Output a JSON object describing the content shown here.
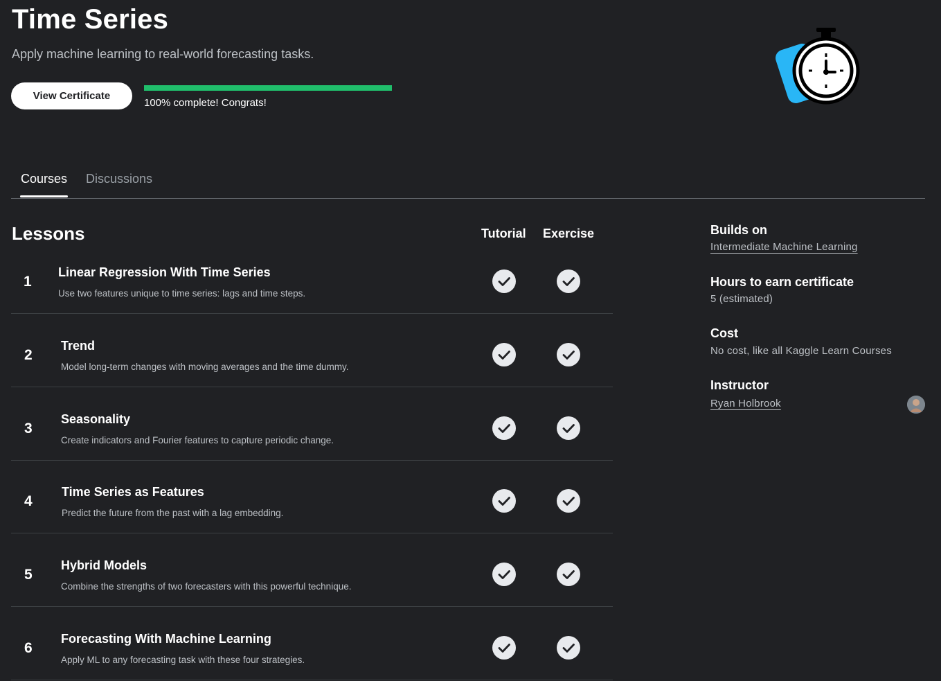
{
  "header": {
    "title": "Time Series",
    "subtitle": "Apply machine learning to real-world forecasting tasks.",
    "certificate_button": "View Certificate",
    "progress_percent": 100,
    "progress_text": "100% complete! Congrats!",
    "hero_icon": "stopwatch-icon"
  },
  "tabs": [
    {
      "label": "Courses",
      "active": true
    },
    {
      "label": "Discussions",
      "active": false
    }
  ],
  "lessons": {
    "heading": "Lessons",
    "columns": {
      "tutorial": "Tutorial",
      "exercise": "Exercise"
    },
    "items": [
      {
        "number": "1",
        "title": "Linear Regression With Time Series",
        "description": "Use two features unique to time series: lags and time steps.",
        "tutorial_done": true,
        "exercise_done": true
      },
      {
        "number": "2",
        "title": "Trend",
        "description": "Model long-term changes with moving averages and the time dummy.",
        "tutorial_done": true,
        "exercise_done": true
      },
      {
        "number": "3",
        "title": "Seasonality",
        "description": "Create indicators and Fourier features to capture periodic change.",
        "tutorial_done": true,
        "exercise_done": true
      },
      {
        "number": "4",
        "title": "Time Series as Features",
        "description": "Predict the future from the past with a lag embedding.",
        "tutorial_done": true,
        "exercise_done": true
      },
      {
        "number": "5",
        "title": "Hybrid Models",
        "description": "Combine the strengths of two forecasters with this powerful technique.",
        "tutorial_done": true,
        "exercise_done": true
      },
      {
        "number": "6",
        "title": "Forecasting With Machine Learning",
        "description": "Apply ML to any forecasting task with these four strategies.",
        "tutorial_done": true,
        "exercise_done": true
      }
    ]
  },
  "sidebar": {
    "builds_on_label": "Builds on",
    "builds_on_value": "Intermediate Machine Learning",
    "hours_label": "Hours to earn certificate",
    "hours_value": "5 (estimated)",
    "cost_label": "Cost",
    "cost_value": "No cost, like all Kaggle Learn Courses",
    "instructor_label": "Instructor",
    "instructor_value": "Ryan Holbrook"
  },
  "colors": {
    "background": "#202124",
    "progress": "#20be6b",
    "icon_accent": "#29b6f6"
  }
}
